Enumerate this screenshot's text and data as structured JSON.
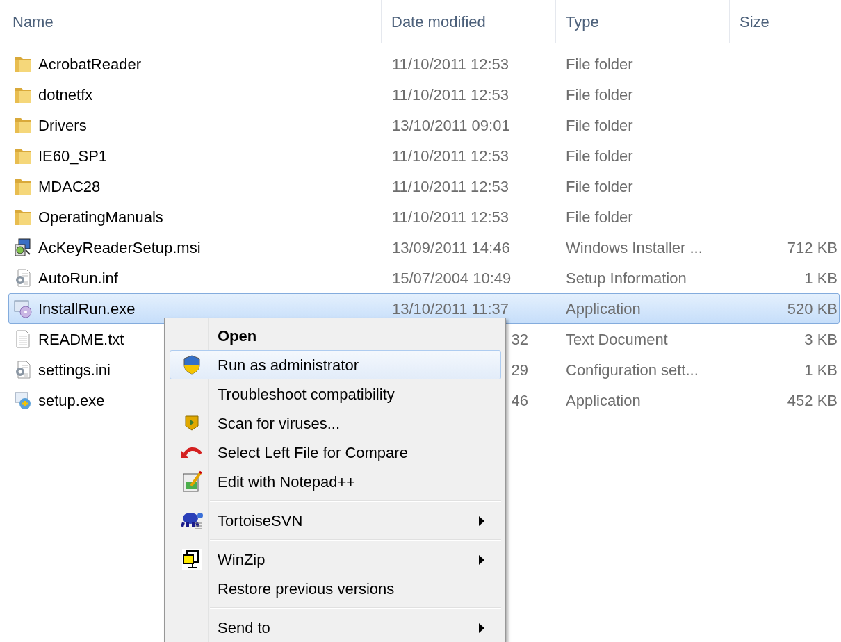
{
  "columns": [
    {
      "label": "Name"
    },
    {
      "label": "Date modified"
    },
    {
      "label": "Type"
    },
    {
      "label": "Size"
    }
  ],
  "files": [
    {
      "name": "AcrobatReader",
      "kind": "folder",
      "date": "11/10/2011 12:53",
      "type": "File folder",
      "selected": false
    },
    {
      "name": "dotnetfx",
      "kind": "folder",
      "date": "11/10/2011 12:53",
      "type": "File folder",
      "selected": false
    },
    {
      "name": "Drivers",
      "kind": "folder",
      "date": "13/10/2011 09:01",
      "type": "File folder",
      "selected": false
    },
    {
      "name": "IE60_SP1",
      "kind": "folder",
      "date": "11/10/2011 12:53",
      "type": "File folder",
      "selected": false
    },
    {
      "name": "MDAC28",
      "kind": "folder",
      "date": "11/10/2011 12:53",
      "type": "File folder",
      "selected": false
    },
    {
      "name": "OperatingManuals",
      "kind": "folder",
      "date": "11/10/2011 12:53",
      "type": "File folder",
      "selected": false
    },
    {
      "name": "AcKeyReaderSetup.msi",
      "kind": "installer",
      "date": "13/09/2011 14:46",
      "type": "Windows Installer ...",
      "size": "712 KB",
      "selected": false
    },
    {
      "name": "AutoRun.inf",
      "kind": "settings",
      "date": "15/07/2004 10:49",
      "type": "Setup Information",
      "size": "1 KB",
      "selected": false
    },
    {
      "name": "InstallRun.exe",
      "kind": "program",
      "date": "13/10/2011 11:37",
      "type": "Application",
      "size": "520 KB",
      "selected": true
    },
    {
      "name": "README.txt",
      "kind": "document",
      "date": "32",
      "date_cut": true,
      "type": "Text Document",
      "size": "3 KB",
      "selected": false
    },
    {
      "name": "settings.ini",
      "kind": "settings",
      "date": "29",
      "date_cut": true,
      "type": "Configuration sett...",
      "size": "1 KB",
      "selected": false
    },
    {
      "name": "setup.exe",
      "kind": "setup",
      "date": "46",
      "date_cut": true,
      "type": "Application",
      "size": "452 KB",
      "selected": false
    }
  ],
  "context_menu": [
    {
      "kind": "item",
      "label": "Open",
      "default": true,
      "selected": false,
      "submenu": false
    },
    {
      "kind": "item",
      "label": "Run as administrator",
      "default": false,
      "selected": true,
      "submenu": false
    },
    {
      "kind": "item",
      "label": "Troubleshoot compatibility",
      "default": false,
      "selected": false,
      "submenu": false
    },
    {
      "kind": "item",
      "label": "Scan for viruses...",
      "default": false,
      "selected": false,
      "submenu": false
    },
    {
      "kind": "item",
      "label": "Select Left File for Compare",
      "default": false,
      "selected": false,
      "submenu": false
    },
    {
      "kind": "item",
      "label": "Edit with Notepad++",
      "default": false,
      "selected": false,
      "submenu": false
    },
    {
      "kind": "separator"
    },
    {
      "kind": "item",
      "label": "TortoiseSVN",
      "default": false,
      "selected": false,
      "submenu": true
    },
    {
      "kind": "separator"
    },
    {
      "kind": "item",
      "label": "WinZip",
      "default": false,
      "selected": false,
      "submenu": true
    },
    {
      "kind": "item",
      "label": "Restore previous versions",
      "default": false,
      "selected": false,
      "submenu": false
    },
    {
      "kind": "separator"
    },
    {
      "kind": "item",
      "label": "Send to",
      "default": false,
      "selected": false,
      "submenu": true
    }
  ]
}
